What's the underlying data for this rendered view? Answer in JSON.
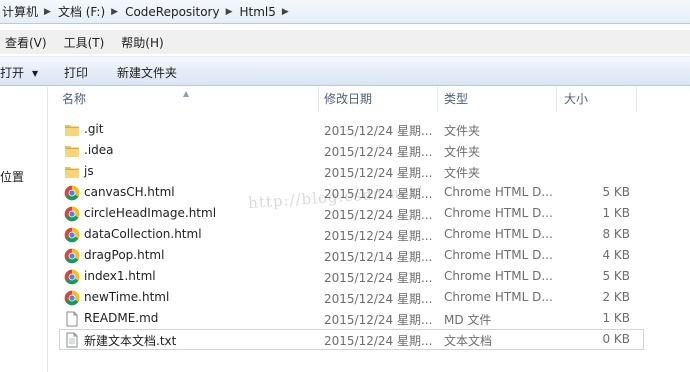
{
  "address": {
    "crumbs": [
      "计算机",
      "文档 (F:)",
      "CodeRepository",
      "Html5"
    ]
  },
  "menu": [
    "查看(V)",
    "工具(T)",
    "帮助(H)"
  ],
  "toolbar": {
    "open_label": "打开",
    "print_label": "打印",
    "new_folder_label": "新建文件夹"
  },
  "nav": {
    "location_label": "位置"
  },
  "columns": {
    "name": "名称",
    "date": "修改日期",
    "type": "类型",
    "size": "大小"
  },
  "files": [
    {
      "name": ".git",
      "date": "2015/12/24 星期...",
      "type": "文件夹",
      "size": "",
      "icon": "folder-icon"
    },
    {
      "name": ".idea",
      "date": "2015/12/24 星期...",
      "type": "文件夹",
      "size": "",
      "icon": "folder-icon"
    },
    {
      "name": "js",
      "date": "2015/12/24 星期...",
      "type": "文件夹",
      "size": "",
      "icon": "folder-icon"
    },
    {
      "name": "canvasCH.html",
      "date": "2015/12/24 星期...",
      "type": "Chrome HTML D...",
      "size": "5 KB",
      "icon": "chrome-icon"
    },
    {
      "name": "circleHeadImage.html",
      "date": "2015/12/24 星期...",
      "type": "Chrome HTML D...",
      "size": "1 KB",
      "icon": "chrome-icon"
    },
    {
      "name": "dataCollection.html",
      "date": "2015/12/24 星期...",
      "type": "Chrome HTML D...",
      "size": "8 KB",
      "icon": "chrome-icon"
    },
    {
      "name": "dragPop.html",
      "date": "2015/12/14 星期...",
      "type": "Chrome HTML D...",
      "size": "4 KB",
      "icon": "chrome-icon"
    },
    {
      "name": "index1.html",
      "date": "2015/12/24 星期...",
      "type": "Chrome HTML D...",
      "size": "5 KB",
      "icon": "chrome-icon"
    },
    {
      "name": "newTime.html",
      "date": "2015/12/24 星期...",
      "type": "Chrome HTML D...",
      "size": "2 KB",
      "icon": "chrome-icon"
    },
    {
      "name": "README.md",
      "date": "2015/12/24 星期...",
      "type": "MD 文件",
      "size": "1 KB",
      "icon": "document-icon"
    },
    {
      "name": "新建文本文档.txt",
      "date": "2015/12/24 星期...",
      "type": "文本文档",
      "size": "0 KB",
      "icon": "text-file-icon"
    }
  ],
  "watermark": "http://blog.csdn.net/"
}
